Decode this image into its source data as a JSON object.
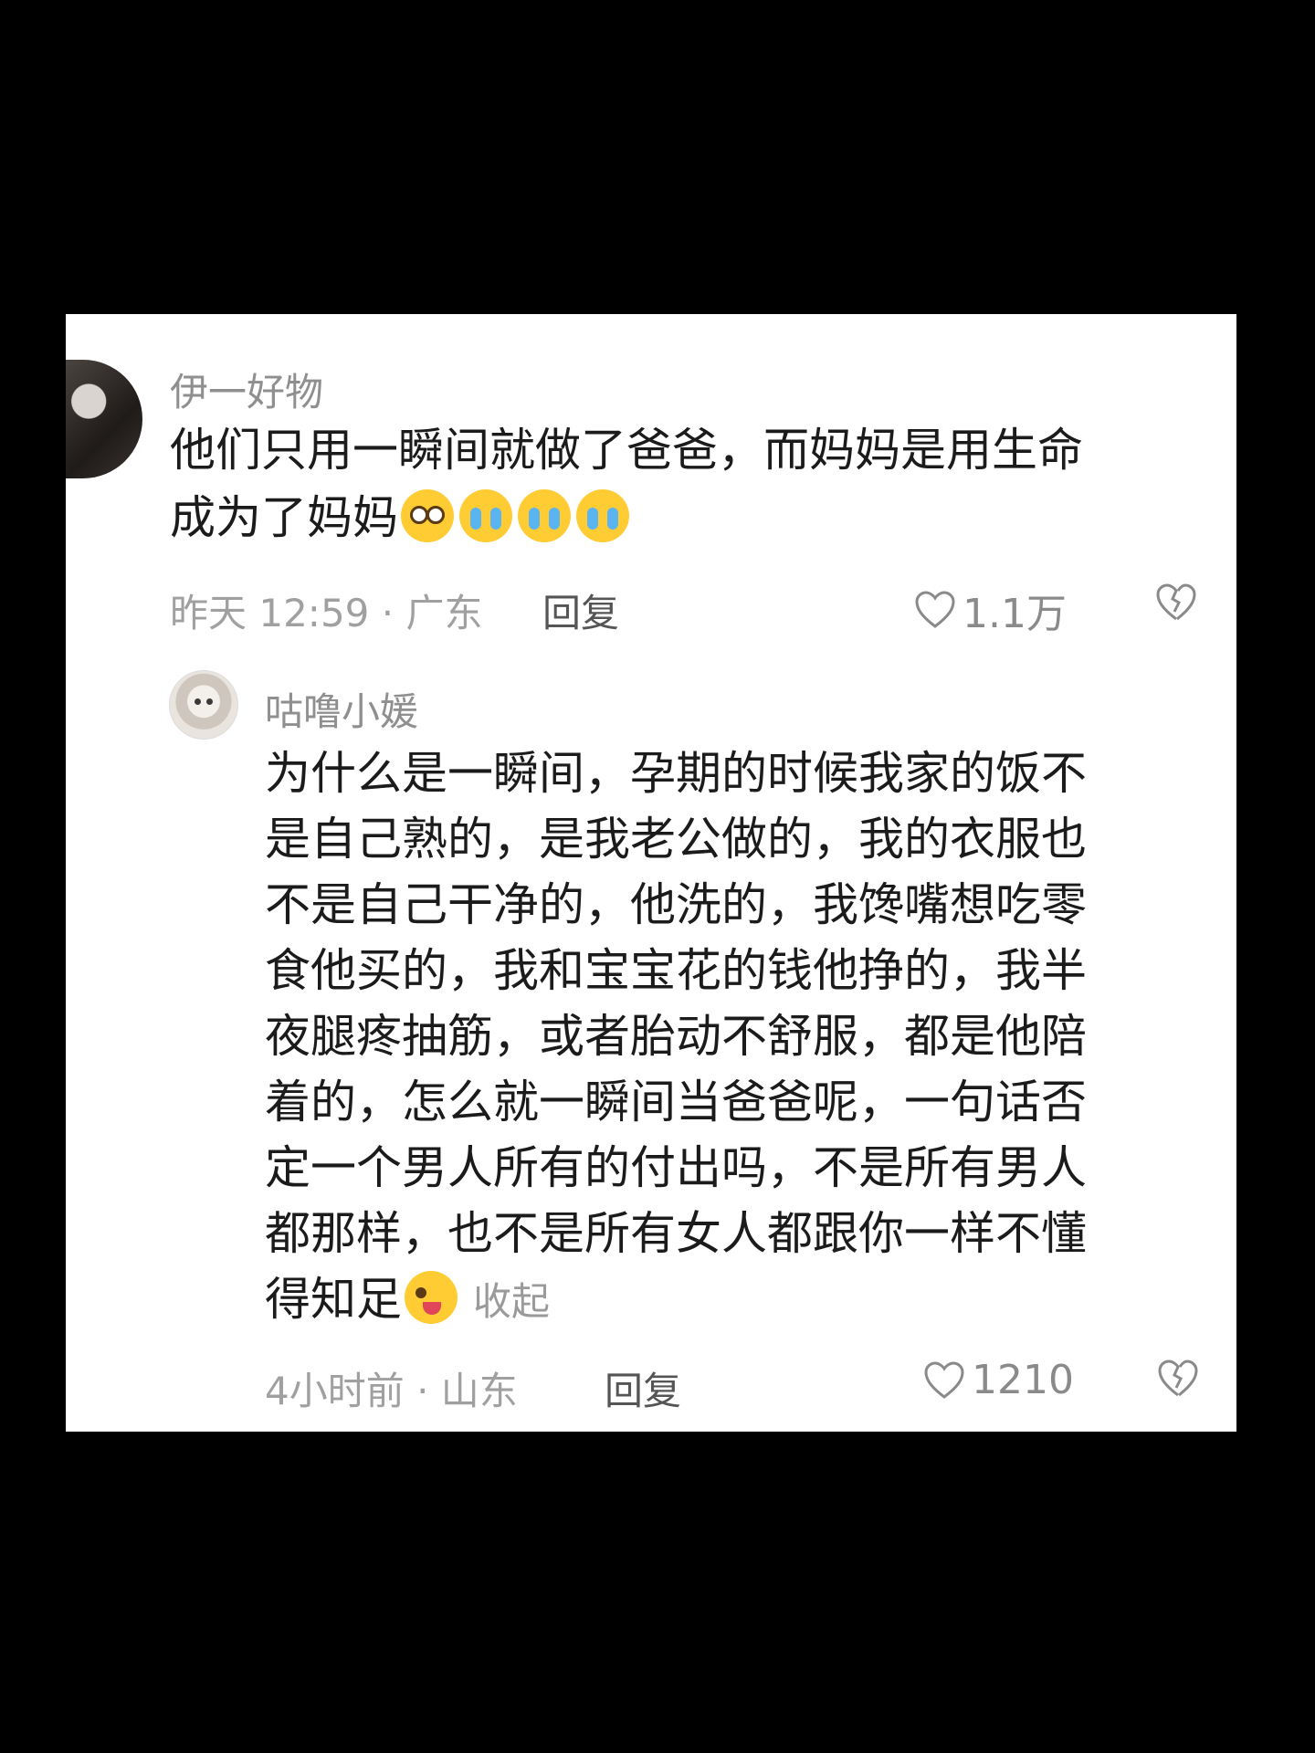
{
  "comment": {
    "username": "伊一好物",
    "text_line1": "他们只用一瞬间就做了爸爸，而妈妈是用生命",
    "text_line2": "成为了妈妈",
    "emojis": [
      "pleading-face",
      "loudly-crying-face",
      "loudly-crying-face",
      "loudly-crying-face"
    ],
    "meta": "昨天 12:59 · 广东",
    "reply_label": "回复",
    "likes": "1.1万",
    "like_icon": "heart-outline-icon",
    "dislike_icon": "broken-heart-icon"
  },
  "reply": {
    "username": "咕噜小媛",
    "lines": [
      "为什么是一瞬间，孕期的时候我家的饭不",
      "是自己熟的，是我老公做的，我的衣服也",
      "不是自己干净的，他洗的，我馋嘴想吃零",
      "食他买的，我和宝宝花的钱他挣的，我半",
      "夜腿疼抽筋，或者胎动不舒服，都是他陪",
      "着的，怎么就一瞬间当爸爸呢，一句话否",
      "定一个男人所有的付出吗，不是所有男人",
      "都那样，也不是所有女人都跟你一样不懂",
      "得知足"
    ],
    "emoji": "winking-face-with-tongue",
    "collapse_label": "收起",
    "meta": "4小时前 · 山东",
    "reply_label": "回复",
    "likes": "1210",
    "like_icon": "heart-outline-icon",
    "dislike_icon": "broken-heart-icon"
  },
  "colors": {
    "background": "#000000",
    "card": "#ffffff",
    "text": "#1b1b1b",
    "muted": "#a0a0a0"
  }
}
